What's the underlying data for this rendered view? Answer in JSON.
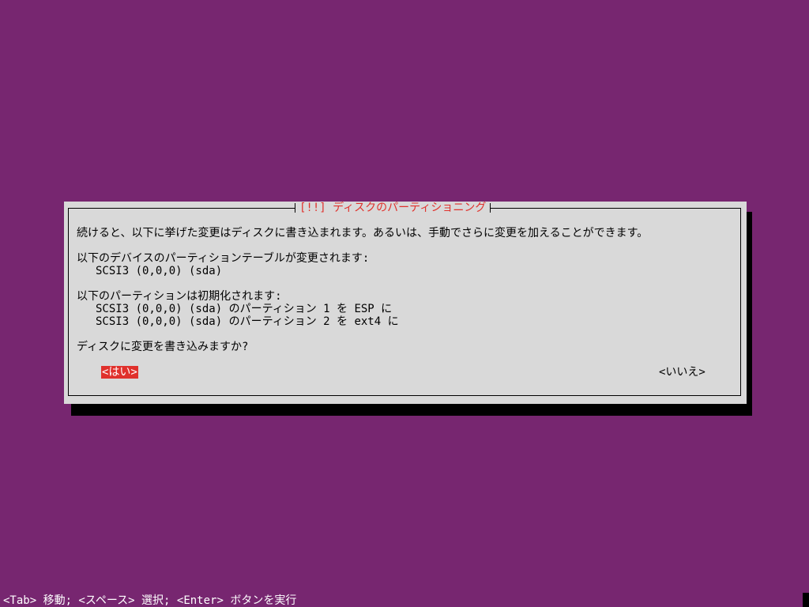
{
  "dialog": {
    "title": "[!!] ディスクのパーティショニング",
    "intro": "続けると、以下に挙げた変更はディスクに書き込まれます。あるいは、手動でさらに変更を加えることができます。",
    "partition_tables_heading": "以下のデバイスのパーティションテーブルが変更されます:",
    "partition_tables_devices": [
      "SCSI3 (0,0,0) (sda)"
    ],
    "format_heading": "以下のパーティションは初期化されます:",
    "format_partitions": [
      "SCSI3 (0,0,0) (sda) のパーティション 1 を ESP に",
      "SCSI3 (0,0,0) (sda) のパーティション 2 を ext4 に"
    ],
    "question": "ディスクに変更を書き込みますか?",
    "yes_label": "<はい>",
    "no_label": "<いいえ>"
  },
  "status_bar": {
    "help_text": "<Tab> 移動; <スペース> 選択; <Enter> ボタンを実行"
  },
  "colors": {
    "background": "#772670",
    "dialog_bg": "#d9d9d9",
    "accent_red": "#e0312c",
    "text": "#000000",
    "status_text": "#ffffff"
  }
}
